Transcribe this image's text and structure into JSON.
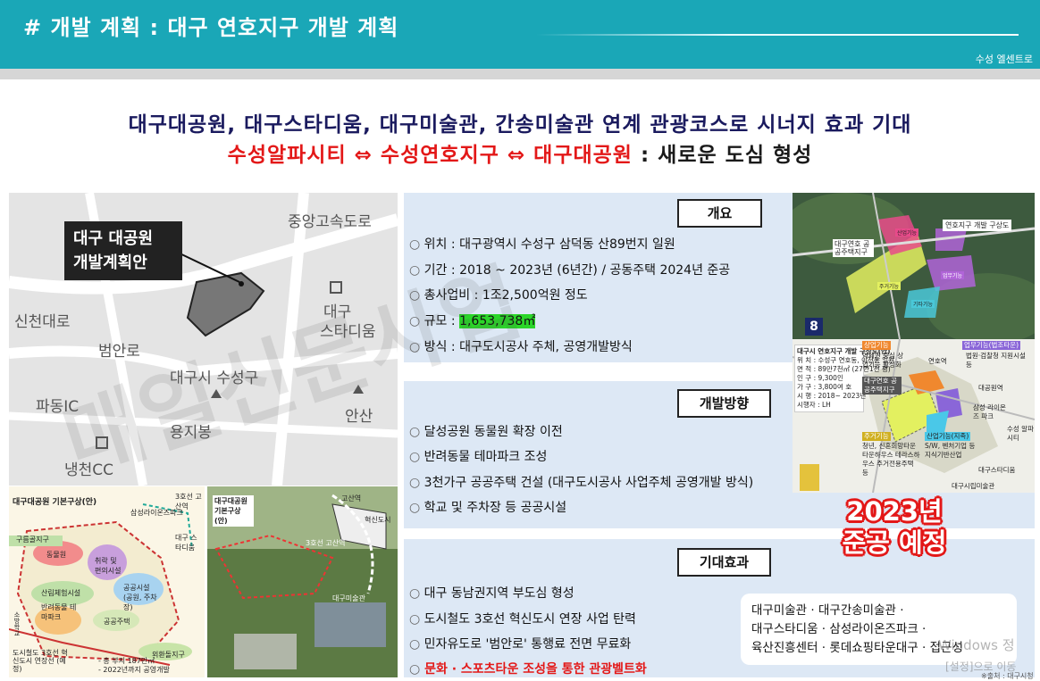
{
  "header": {
    "title": "# 개발 계획 : 대구 연호지구 개발 계획",
    "brand": "수성 엘센트로"
  },
  "subtitle": {
    "line1": "대구대공원, 대구스타디움, 대구미술관, 간송미술관 연계 관광코스로 시너지 효과 기대",
    "line2_red": "수성알파시티 ⇔ 수성연호지구 ⇔ 대구대공원",
    "line2_black": " : 새로운 도심 형성"
  },
  "map": {
    "plan_title_1": "대구 대공원",
    "plan_title_2": "개발계획안",
    "labels": {
      "expressway": "중앙고속도로",
      "sincheon": "신천대로",
      "beoman": "범안로",
      "stadium_1": "대구",
      "stadium_2": "스타디움",
      "suseong": "대구시 수성구",
      "padong": "파동IC",
      "yongji": "용지봉",
      "ansan": "안산",
      "naengcheon": "냉천CC"
    }
  },
  "thumb1": {
    "title": "대구대공원 기본구상(안)",
    "labels": [
      "구름골지구",
      "동물원",
      "취락 및 편의시설",
      "공공시설 (공원, 주차장)",
      "반려동물 테마파크",
      "산림체험시설",
      "공공주택",
      "외환돌지구",
      "도시철도 3호선 혁신도시 연장선 (예정)",
      "- 총 부지 187만㎡",
      "- 2022년까지 공영개발",
      "삼성라이온즈파크",
      "대구 스타디움",
      "3호선 고산역",
      "소방학교"
    ]
  },
  "thumb2": {
    "title": "대구대공원 기본구상(안)",
    "labels": [
      "고산역",
      "혁신도시",
      "대구미술관",
      "3호선 고산역"
    ]
  },
  "overview": {
    "title": "개요",
    "items": [
      {
        "label": "위치",
        "value": "대구광역시 수성구 삼덕동 산89번지 일원"
      },
      {
        "label": "기간",
        "value": "2018 ~ 2023년 (6년간) / 공동주택 2024년 준공"
      },
      {
        "label": "총사업비",
        "value": "1조2,500억원 정도"
      },
      {
        "label": "규모",
        "value": "1,653,738㎡"
      },
      {
        "label": "방식",
        "value": "대구도시공사 주체, 공영개발방식"
      }
    ]
  },
  "direction": {
    "title": "개발방향",
    "items": [
      "달성공원 동물원 확장 이전",
      "반려동물 테마파크 조성",
      "3천가구 공공주택 건설 (대구도시공사 사업주체 공영개발 방식)",
      "학교 및 주차장 등 공공시설"
    ]
  },
  "effect": {
    "title": "기대효과",
    "items": [
      "대구 동남권지역 부도심 형성",
      "도시철도 3호선 혁신도시 연장 사업 탄력",
      "민자유도로 '범안로' 통행료 전면 무료화"
    ],
    "highlight": "문화 · 스포츠타운 조성을 통한 관광벨트화",
    "box_lines": [
      "대구미술관 · 대구간송미술관 ·",
      "대구스타디움 · 삼성라이온즈파크 ·",
      "육산진흥센터 · 롯데쇼핑타운대구 · 접근성"
    ]
  },
  "photo1": {
    "title": "연호지구 개발 구상도",
    "labels": [
      "대구연호 공공주택지구",
      "주거기능",
      "산업기능",
      "업무기능",
      "기타기능"
    ],
    "badge": "8"
  },
  "photo2": {
    "info_title": "대구시 연호지구 개발 구상도(안)",
    "info_lines": [
      "위 치 : 수성구 연호동, 이천동 일원",
      "면 적 : 89만7천㎡ (27만1천 평)",
      "인 구 : 9,300인",
      "가 구 : 3,800여 호",
      "시 행 : 2018~ 2023년",
      "시행자 : LH"
    ],
    "labels": [
      "상업기능",
      "역세권 중심 상업기능 활성화",
      "연호역",
      "업무기능(법조타운)",
      "법원·검찰청 지원시설 등",
      "대구연호 공공주택지구",
      "대공원역",
      "삼성 라이온즈 파크",
      "수성 알파시티",
      "주거기능",
      "청년, 신혼희망타운 타운하우스 테라스하우스 주거전용주택 등",
      "산업기능(지족)",
      "S/W, 벤처기업 등 지식기반산업",
      "대구스타디움",
      "대구시립미술관"
    ]
  },
  "badge": {
    "line1": "2023년",
    "line2": "준공 예정"
  },
  "watermark": "매일신문사업",
  "os_overlay": {
    "line1": "Windows 정",
    "line2": "[설정]으로 이동",
    "line3": "※출처 : 대구시청"
  }
}
